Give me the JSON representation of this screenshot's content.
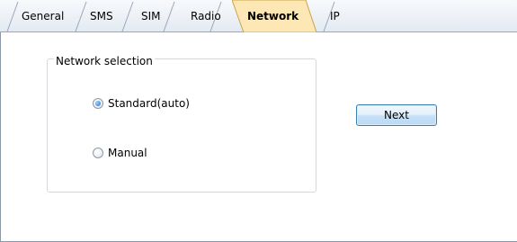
{
  "tabs": [
    {
      "label": "General",
      "active": false
    },
    {
      "label": "SMS",
      "active": false
    },
    {
      "label": "SIM",
      "active": false
    },
    {
      "label": "Radio",
      "active": false
    },
    {
      "label": "Network",
      "active": true
    },
    {
      "label": "IP",
      "active": false
    }
  ],
  "network_selection": {
    "legend": "Network selection",
    "options": [
      {
        "label": "Standard(auto)",
        "selected": true
      },
      {
        "label": "Manual",
        "selected": false
      }
    ]
  },
  "buttons": {
    "next_label": "Next"
  },
  "colors": {
    "active_tab": "#fde7b4",
    "tab_strip": "#e8edf3",
    "button_border": "#3c7fb1"
  }
}
